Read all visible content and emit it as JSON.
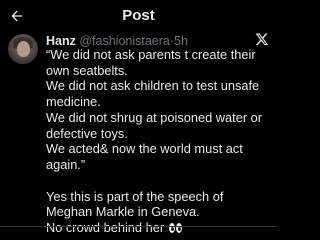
{
  "header": {
    "title": "Post",
    "back_icon": "arrow-left-icon"
  },
  "tweet": {
    "author_name": "Hanz",
    "author_handle": "@fashionistaera",
    "separator": "·",
    "time": "5h",
    "platform_icon": "x-logo-icon",
    "lines": [
      "“We did not ask parents t create their own seatbelts.",
      "We did not ask children to test unsafe medicine.",
      "We did not shrug at poisoned water or defective toys.",
      "We acted& now the world must act again.”"
    ],
    "comment_lines": [
      "Yes this is part of the speech of Meghan Markle in Geneva.",
      "No crowd behind her"
    ],
    "emoji": "eyes-emoji"
  },
  "colors": {
    "background": "#000000",
    "text": "#e7e9ea",
    "muted": "#71767b"
  }
}
